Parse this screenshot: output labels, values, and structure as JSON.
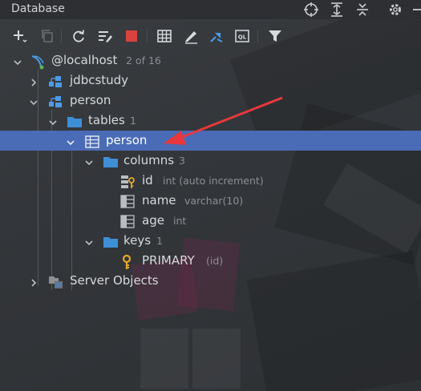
{
  "panel": {
    "title": "Database",
    "header_icons": [
      "crosshair-icon",
      "expand-all-icon",
      "collapse-all-icon",
      "gear-icon",
      "minimize-icon"
    ]
  },
  "toolbar": {
    "buttons": [
      "add-icon",
      "duplicate-icon",
      "refresh-icon",
      "schema-sync-icon",
      "stop-icon",
      "table-editor-icon",
      "edit-icon",
      "jump-to-icon",
      "query-console-icon",
      "filter-icon"
    ]
  },
  "tree": {
    "host": {
      "label": "@localhost",
      "hint": "2 of 16"
    },
    "db_jdbcstudy": {
      "label": "jdbcstudy"
    },
    "db_person": {
      "label": "person"
    },
    "tables": {
      "label": "tables",
      "hint": "1"
    },
    "table_person": {
      "label": "person"
    },
    "columns": {
      "label": "columns",
      "hint": "3"
    },
    "col_id": {
      "label": "id",
      "hint": "int (auto increment)"
    },
    "col_name": {
      "label": "name",
      "hint": "varchar(10)"
    },
    "col_age": {
      "label": "age",
      "hint": "int"
    },
    "keys": {
      "label": "keys",
      "hint": "1"
    },
    "key_primary": {
      "label": "PRIMARY",
      "hint": "(id)"
    },
    "server_objects": {
      "label": "Server Objects"
    }
  },
  "colors": {
    "selection": "#4a6bb5",
    "annotation_arrow": "#e8383d",
    "folder": "#3f8fd6",
    "key": "#e5a72b"
  }
}
